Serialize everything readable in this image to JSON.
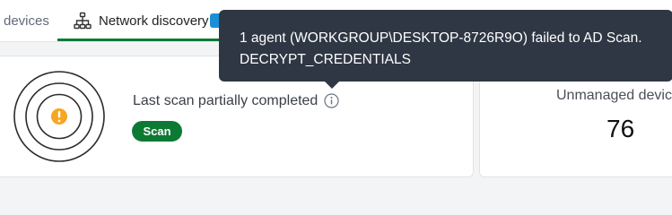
{
  "tabs": {
    "devices_label": "devices",
    "network_discovery_label": "Network discovery",
    "network_discovery_icon": "network-tree-icon",
    "active_tab": "Network discovery"
  },
  "scan_card": {
    "status_text": "Last scan partially completed",
    "status_icon": "warning-icon",
    "info_icon": "info-icon",
    "scan_button_label": "Scan"
  },
  "unmanaged_card": {
    "label": "Unmanaged devices",
    "count": "76"
  },
  "tooltip": {
    "line1": "1 agent (WORKGROUP\\DESKTOP-8726R9O) failed to AD Scan.",
    "line2": "DECRYPT_CREDENTIALS"
  },
  "colors": {
    "accent_green": "#0d7a34",
    "warning_orange": "#f6a623",
    "tooltip_bg": "#2f3744",
    "badge_blue": "#1b8fd6"
  }
}
